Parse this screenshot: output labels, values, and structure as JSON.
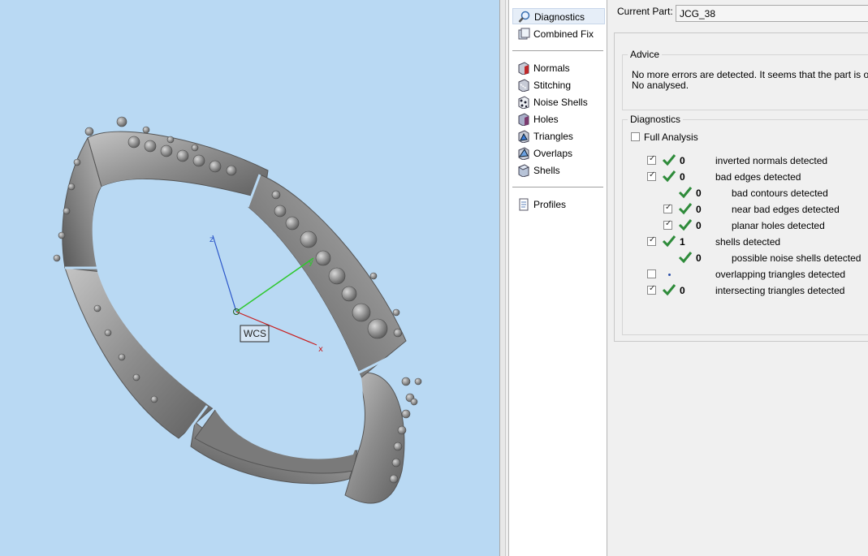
{
  "viewport": {
    "wcs_label": "WCS",
    "axis_x": "x",
    "axis_y": "y",
    "axis_z": "z"
  },
  "sidebar": {
    "items": [
      {
        "label": "Diagnostics",
        "icon": "magnifier-icon",
        "selected": true
      },
      {
        "label": "Combined Fix",
        "icon": "combined-fix-icon"
      },
      {
        "label": "Normals",
        "icon": "normals-icon"
      },
      {
        "label": "Stitching",
        "icon": "stitching-icon"
      },
      {
        "label": "Noise Shells",
        "icon": "noise-shells-icon"
      },
      {
        "label": "Holes",
        "icon": "holes-icon"
      },
      {
        "label": "Triangles",
        "icon": "triangles-icon"
      },
      {
        "label": "Overlaps",
        "icon": "overlaps-icon"
      },
      {
        "label": "Shells",
        "icon": "shells-icon"
      },
      {
        "label": "Profiles",
        "icon": "profiles-icon"
      }
    ]
  },
  "main": {
    "current_part_label": "Current Part:",
    "current_part_value": "JCG_38",
    "advice_title": "Advice",
    "advice_text": "No more errors are detected. It seems that the part is ok. No analysed.",
    "diagnostics_title": "Diagnostics",
    "full_analysis_label": "Full Analysis",
    "rows": [
      {
        "label": "inverted normals detected",
        "count": "0",
        "checked": true,
        "status": "ok"
      },
      {
        "label": "bad edges detected",
        "count": "0",
        "checked": true,
        "status": "ok"
      },
      {
        "label": "bad contours detected",
        "count": "0",
        "checked": null,
        "status": "ok"
      },
      {
        "label": "near bad edges detected",
        "count": "0",
        "checked": true,
        "status": "ok"
      },
      {
        "label": "planar holes detected",
        "count": "0",
        "checked": true,
        "status": "ok"
      },
      {
        "label": "shells detected",
        "count": "1",
        "checked": true,
        "status": "ok"
      },
      {
        "label": "possible noise shells detected",
        "count": "0",
        "checked": null,
        "status": "ok"
      },
      {
        "label": "overlapping triangles detected",
        "count": "",
        "checked": false,
        "status": "not-analysed"
      },
      {
        "label": "intersecting triangles detected",
        "count": "0",
        "checked": true,
        "status": "ok"
      }
    ]
  },
  "colors": {
    "viewport_bg": "#b9d9f3",
    "ok_tick": "#2e8b3a",
    "model": "#8f8f8f"
  }
}
